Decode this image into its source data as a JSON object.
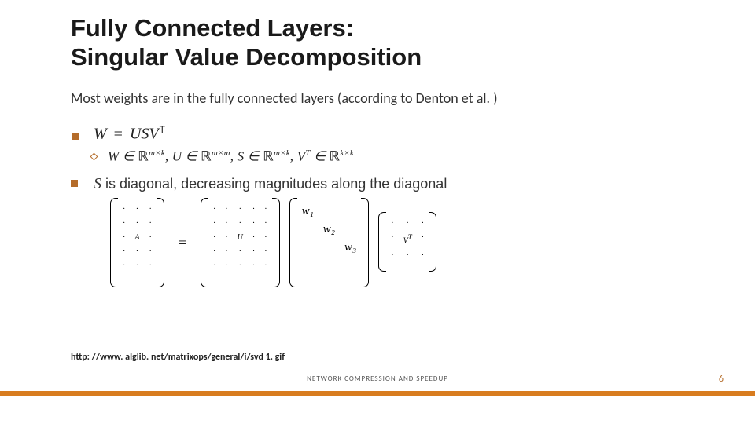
{
  "title_line1": "Fully Connected Layers:",
  "title_line2": "Singular Value Decomposition",
  "main_bullet": "Most weights are in the fully connected layers (according to Denton et al. )",
  "formula_main": {
    "lhs": "W",
    "eq": "=",
    "rhs": "USV",
    "superscript": "T"
  },
  "formula_dims": {
    "parts": [
      {
        "var": "W",
        "set": "ℝ",
        "exp": "m×k"
      },
      {
        "var": "U",
        "set": "ℝ",
        "exp": "m×m"
      },
      {
        "var": "S",
        "set": "ℝ",
        "exp": "m×k"
      },
      {
        "var": "V",
        "set": "ℝ",
        "exp": "k×k",
        "trans": "T"
      }
    ],
    "sep": ", ",
    "elem": " ∈ "
  },
  "diagonal_text": {
    "svar": "S",
    "rest": " is diagonal, decreasing magnitudes along the diagonal"
  },
  "svd_labels": {
    "A": "A",
    "eq": "=",
    "U": "U",
    "w1": "w₁",
    "w2": "w₂",
    "w3": "w₃",
    "VT": "V",
    "VT_sup": "T"
  },
  "source": "http: //www. alglib. net/matrixops/general/i/svd 1. gif",
  "footer": "NETWORK COMPRESSION AND SPEEDUP",
  "page": "6"
}
